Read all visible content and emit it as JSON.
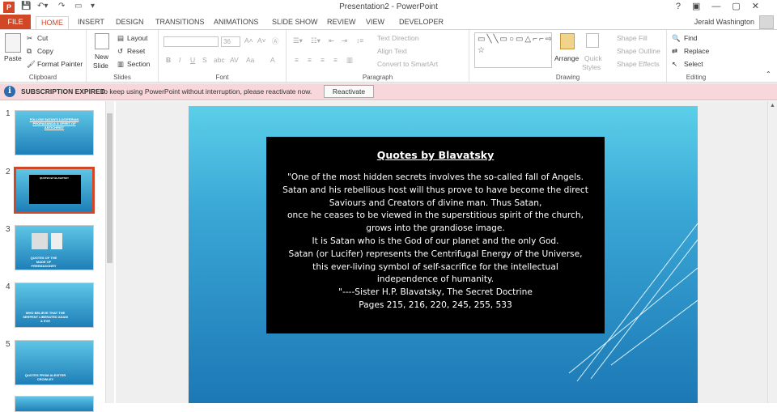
{
  "window": {
    "title": "Presentation2 - PowerPoint",
    "app_icon": "P",
    "qat_icons": [
      "save-icon",
      "undo-icon",
      "redo-icon",
      "start-from-beginning-icon"
    ],
    "controls": [
      "?",
      "▣",
      "—",
      "▢",
      "✕"
    ]
  },
  "tabs": [
    "FILE",
    "HOME",
    "INSERT",
    "DESIGN",
    "TRANSITIONS",
    "ANIMATIONS",
    "SLIDE SHOW",
    "REVIEW",
    "VIEW",
    "DEVELOPER"
  ],
  "active_tab": "HOME",
  "user_name": "Jerald Washington",
  "ribbon": {
    "clipboard": {
      "paste": "Paste",
      "cut": "Cut",
      "copy": "Copy",
      "format_painter": "Format Painter",
      "label": "Clipboard"
    },
    "slides": {
      "new_slide_1": "New",
      "new_slide_2": "Slide",
      "layout": "Layout",
      "reset": "Reset",
      "section": "Section",
      "label": "Slides"
    },
    "font": {
      "font_size": "36",
      "label": "Font"
    },
    "paragraph": {
      "text_direction": "Text Direction",
      "align_text": "Align Text",
      "convert_smartart": "Convert to SmartArt",
      "label": "Paragraph"
    },
    "drawing": {
      "arrange": "Arrange",
      "quick_styles_1": "Quick",
      "quick_styles_2": "Styles",
      "shape_fill": "Shape Fill",
      "shape_outline": "Shape Outline",
      "shape_effects": "Shape Effects",
      "label": "Drawing"
    },
    "editing": {
      "find": "Find",
      "replace": "Replace",
      "select": "Select",
      "label": "Editing"
    }
  },
  "message_bar": {
    "title": "SUBSCRIPTION EXPIRED",
    "text": "To keep using PowerPoint without interruption, please reactivate now.",
    "button": "Reactivate"
  },
  "thumbnails": [
    {
      "num": "1",
      "text": "FOLLOW SATAN'S LUCIFERIAN PROPAGANDA & SPIRIT OF ANTICHRIST"
    },
    {
      "num": "2",
      "text": "QUOTES BY BLAVATSKY"
    },
    {
      "num": "3",
      "text": "QUOTES OF THE MADE OF FREEMASONRY"
    },
    {
      "num": "4",
      "text": "WHO BELIEVE THAT THE SERPENT LIBERATED ADAM & EVE"
    },
    {
      "num": "5",
      "text": "QUOTES FROM ALEISTER CROWLEY"
    }
  ],
  "slide": {
    "title": "Quotes by Blavatsky",
    "lines": [
      "\"One of the most hidden secrets involves the so-called fall of Angels.",
      "Satan and his rebellious host will thus prove to have become the direct",
      "Saviours and Creators of divine man. Thus Satan,",
      "once he ceases to be viewed in the superstitious spirit of the church,",
      "grows into the grandiose image.",
      "It is Satan who is the God of our planet and the only God.",
      "Satan (or Lucifer) represents the Centrifugal Energy of the Universe,",
      "this ever-living symbol of self-sacrifice for the intellectual",
      "independence of humanity.",
      "\"----Sister H.P. Blavatsky, The Secret Doctrine",
      "Pages 215, 216, 220, 245, 255, 533"
    ]
  }
}
